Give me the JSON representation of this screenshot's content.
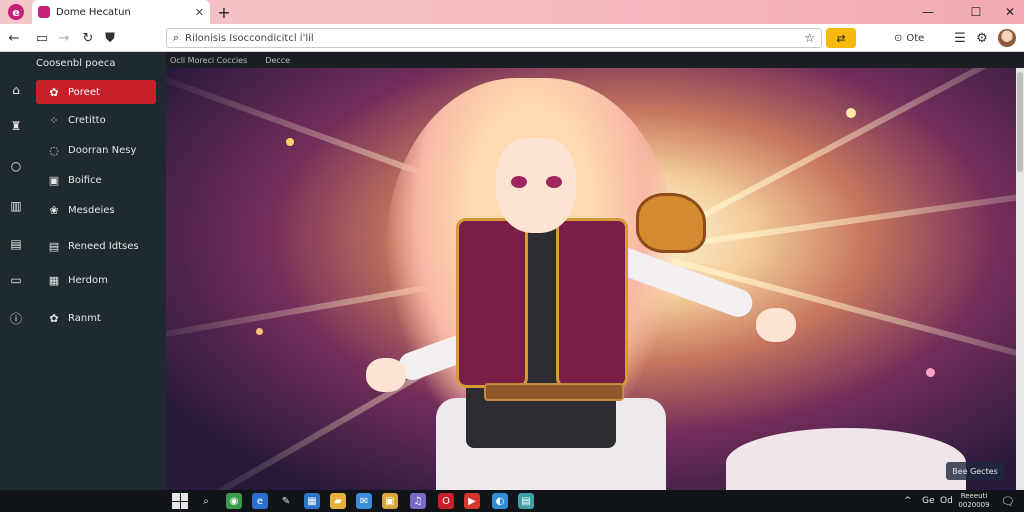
{
  "browser": {
    "tab_title": "Dome Hecatun",
    "tab_close": "✕",
    "new_tab": "+",
    "window": {
      "minimize": "—",
      "maximize": "☐",
      "close": "✕"
    }
  },
  "toolbar": {
    "back": "←",
    "url": "Rilonisis Isoccondicitcl i'lil",
    "star": "☆",
    "profile_label": "Ote",
    "menu": "☰"
  },
  "sidebar": {
    "heading": "Coosenbl poeca",
    "items": [
      {
        "label": "Poreet",
        "icon": "✿"
      },
      {
        "label": "Cretitto",
        "icon": "⁘"
      },
      {
        "label": "Doorran Nesy",
        "icon": "◌"
      },
      {
        "label": "Boifice",
        "icon": "▣"
      },
      {
        "label": "Mesdeies",
        "icon": "❀"
      },
      {
        "label": "Reneed Idtses",
        "icon": "▤"
      },
      {
        "label": "Herdom",
        "icon": "▦"
      },
      {
        "label": "Ranmt",
        "icon": "✿"
      }
    ],
    "rail_icons": [
      "⌂",
      "♜",
      "○",
      "▥",
      "▤",
      "▭",
      "ⓘ"
    ]
  },
  "content": {
    "breadcrumb": [
      "Ocll Moreci Coccies",
      "Decce"
    ],
    "caption": "Bee Gectes"
  },
  "taskbar": {
    "clock_time": "Reeeuti",
    "clock_date": "0020009",
    "tray": [
      "^",
      "Ge",
      "Od"
    ]
  },
  "colors": {
    "accent_red": "#c8202a",
    "sidebar_bg": "#1f2a30",
    "yellow_button": "#f6b90c",
    "tabstrip_pink": "#f3c7c9"
  }
}
